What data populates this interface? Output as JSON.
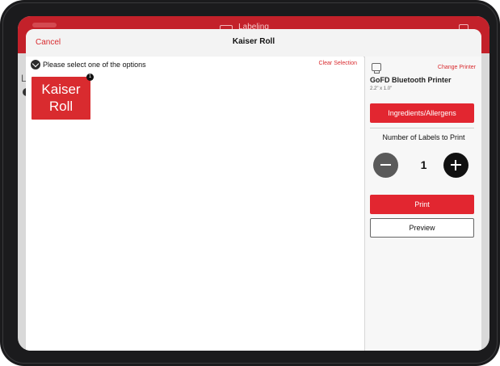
{
  "background_app": {
    "title": "Labeling",
    "left_letter": "L"
  },
  "modal": {
    "cancel_label": "Cancel",
    "title": "Kaiser Roll"
  },
  "left_panel": {
    "options_prompt": "Please select one of the options",
    "clear_selection_label": "Clear Selection",
    "option": {
      "label_line1": "Kaiser",
      "label_line2": "Roll",
      "badge": "1"
    }
  },
  "right_panel": {
    "change_printer_label": "Change Printer",
    "printer_name": "GoFD Bluetooth Printer",
    "printer_size": "2.2\" x 1.0\"",
    "ingredients_label": "Ingredients/Allergens",
    "labels_title": "Number of Labels to Print",
    "count": "1",
    "print_label": "Print",
    "preview_label": "Preview"
  },
  "icons": {
    "chevron": "chevron-down-icon",
    "printer": "printer-icon",
    "minus": "minus-icon",
    "plus": "plus-icon"
  },
  "colors": {
    "accent_red": "#e22630",
    "header_red": "#c3212a",
    "text_dark": "#111111"
  }
}
